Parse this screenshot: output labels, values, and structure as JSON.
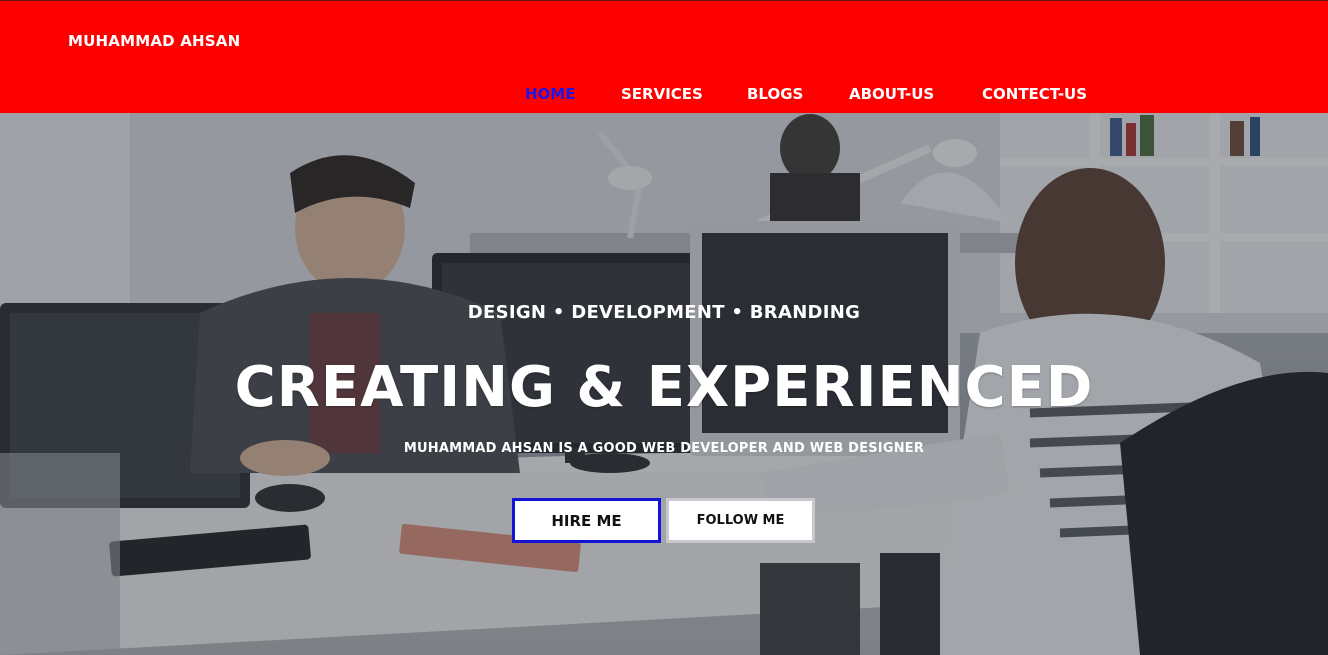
{
  "header": {
    "brand": "MUHAMMAD AHSAN",
    "background_color": "#ff0000",
    "nav": [
      {
        "label": "HOME",
        "active": true,
        "active_color": "#1d17e6"
      },
      {
        "label": "SERVICES",
        "active": false
      },
      {
        "label": "BLOGS",
        "active": false
      },
      {
        "label": "ABOUT-US",
        "active": false
      },
      {
        "label": "CONTECT-US",
        "active": false
      }
    ]
  },
  "hero": {
    "image_description": "office-workspace-photo",
    "tagline": "DESIGN • DEVELOPMENT • BRANDING",
    "headline": "CREATING & EXPERIENCED",
    "subline": "MUHAMMAD AHSAN IS A GOOD WEB DEVELOPER AND WEB DESIGNER",
    "buttons": {
      "hire_label": "HIRE ME",
      "follow_label": "FOLLOW ME",
      "hire_border_color": "#1414d6"
    }
  }
}
